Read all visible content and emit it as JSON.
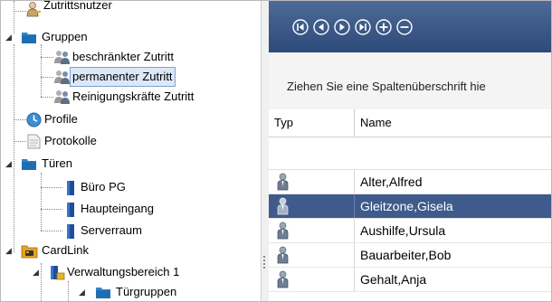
{
  "tree": {
    "items": [
      {
        "label": "Zutrittsnutzer",
        "icon": "user-key-icon"
      },
      {
        "label": "Gruppen",
        "icon": "folder-icon",
        "expanded": true
      },
      {
        "label": "beschränkter Zutritt",
        "icon": "user-group-icon"
      },
      {
        "label": "permanenter Zutritt",
        "icon": "user-group-icon",
        "selected": true
      },
      {
        "label": "Reinigungskräfte Zutritt",
        "icon": "user-group-icon"
      },
      {
        "label": "Profile",
        "icon": "clock-icon"
      },
      {
        "label": "Protokolle",
        "icon": "document-icon"
      },
      {
        "label": "Türen",
        "icon": "folder-icon",
        "expanded": true
      },
      {
        "label": "Büro PG",
        "icon": "door-icon"
      },
      {
        "label": "Haupteingang",
        "icon": "door-icon"
      },
      {
        "label": "Serverraum",
        "icon": "door-icon"
      },
      {
        "label": "CardLink",
        "icon": "cardlink-icon",
        "expanded": true
      },
      {
        "label": "Verwaltungsbereich 1",
        "icon": "area-icon",
        "expanded": true
      },
      {
        "label": "Türgruppen",
        "icon": "folder-icon",
        "expanded": true
      }
    ]
  },
  "toolbar": {
    "buttons": [
      "first-record-icon",
      "previous-record-icon",
      "next-record-icon",
      "last-record-icon",
      "add-record-icon",
      "remove-record-icon"
    ]
  },
  "grid": {
    "group_hint": "Ziehen Sie eine Spaltenüberschrift hie",
    "columns": [
      "Typ",
      "Name"
    ],
    "rows": [
      {
        "name": "Alter,Alfred"
      },
      {
        "name": "Gleitzone,Gisela",
        "selected": true
      },
      {
        "name": "Aushilfe,Ursula"
      },
      {
        "name": "Bauarbeiter,Bob"
      },
      {
        "name": "Gehalt,Anja"
      }
    ]
  },
  "colors": {
    "toolbar": "#3b5787",
    "selected_row": "#3f5b8c",
    "tree_selection": "#dbe8f8",
    "folder": "#2e86c9"
  }
}
